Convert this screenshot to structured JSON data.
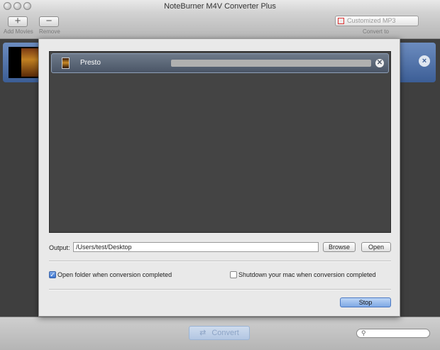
{
  "window": {
    "title": "NoteBurner M4V Converter Plus"
  },
  "toolbar": {
    "add_movies_label": "Add Movies",
    "remove_label": "Remove",
    "convert_to_label": "Convert to",
    "format_selected": "Customized MP3",
    "format_icon": "music-file-icon"
  },
  "main": {
    "movie_row_selected": true
  },
  "sheet": {
    "items": [
      {
        "name": "Presto",
        "progress": 0.0
      }
    ],
    "output_label": "Output:",
    "output_path": "/Users/test/Desktop",
    "browse_label": "Browse",
    "open_label": "Open",
    "open_folder_checked": true,
    "open_folder_label": "Open folder when conversion completed",
    "shutdown_checked": false,
    "shutdown_label": "Shutdown your mac when conversion completed",
    "stop_label": "Stop"
  },
  "bottombar": {
    "convert_label": "Convert",
    "convert_icon": "refresh-arrows-icon",
    "search_placeholder": "",
    "search_icon": "magnifier-icon"
  },
  "colors": {
    "selection_blue": "#3c5e96",
    "stop_button": "#7ea8e4",
    "dark_panel": "#444444"
  }
}
